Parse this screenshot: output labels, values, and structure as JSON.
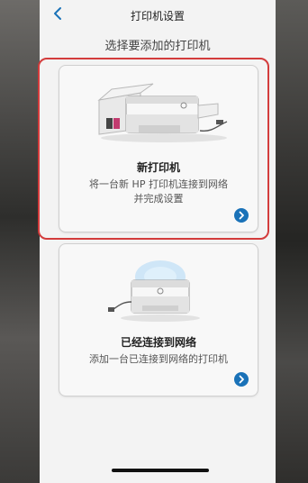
{
  "header": {
    "title": "打印机设置",
    "back_icon": "chevron-left-icon"
  },
  "subtitle": "选择要添加的打印机",
  "options": [
    {
      "title": "新打印机",
      "description_line1": "将一台新 HP 打印机连接到网络",
      "description_line2": "并完成设置",
      "icon": "printer-unboxing-illustration",
      "highlighted": true
    },
    {
      "title": "已经连接到网络",
      "description_line1": "添加一台已连接到网络的打印机",
      "icon": "networked-printer-illustration",
      "highlighted": false
    }
  ],
  "colors": {
    "accent": "#1a72b8",
    "highlight_border": "#d33c3c",
    "wifi_glow": "#cfe6f7"
  }
}
